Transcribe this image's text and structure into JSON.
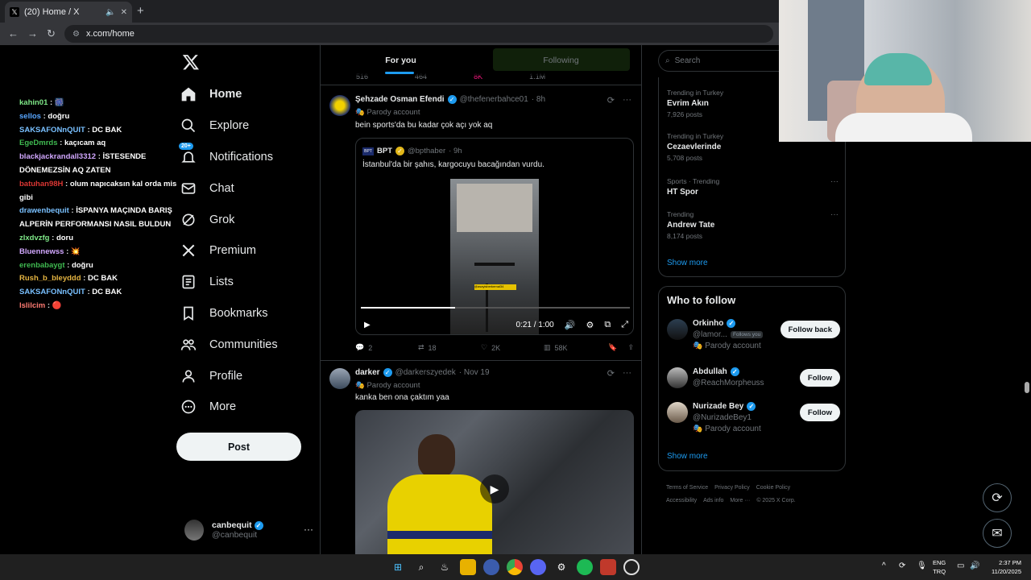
{
  "browser": {
    "tab_title": "(20) Home / X",
    "url": "x.com/home"
  },
  "chat": [
    {
      "user": "kahin01",
      "color": "#7ee787",
      "msg": "🎆"
    },
    {
      "user": "sellos",
      "color": "#58a6ff",
      "msg": "doğru"
    },
    {
      "user": "SAKSAFONnQUIT",
      "color": "#79c0ff",
      "msg": "DC BAK"
    },
    {
      "user": "EgeDmrds",
      "color": "#3fb950",
      "msg": "kaçıcam aq"
    },
    {
      "user": "blackjackrandall3312",
      "color": "#d2a8ff",
      "msg": "İSTESENDE DÖNEMEZSİN AQ ZATEN"
    },
    {
      "user": "batuhan98H",
      "color": "#da3633",
      "msg": "olum napıcaksın kal orda mis gibi"
    },
    {
      "user": "drawenbequit",
      "color": "#79c0ff",
      "msg": "İSPANYA MAÇINDA BARIŞ ALPERİN PERFORMANSI NASIL BULDUN"
    },
    {
      "user": "zlxdvzfg",
      "color": "#7ee787",
      "msg": "doru"
    },
    {
      "user": "Bluennewss",
      "color": "#d2a8ff",
      "msg": "💥"
    },
    {
      "user": "erenbabaygt",
      "color": "#3fb950",
      "msg": "doğru"
    },
    {
      "user": "Rush_b_bleyddd",
      "color": "#e3b341",
      "msg": "DC BAK"
    },
    {
      "user": "SAKSAFONnQUIT",
      "color": "#79c0ff",
      "msg": "DC BAK"
    },
    {
      "user": "lslilcim",
      "color": "#ff7b72",
      "msg": "🔴"
    }
  ],
  "nav": [
    {
      "label": "Home",
      "icon": "home-icon"
    },
    {
      "label": "Explore",
      "icon": "search-icon"
    },
    {
      "label": "Notifications",
      "icon": "bell-icon",
      "badge": "20+"
    },
    {
      "label": "Chat",
      "icon": "mail-icon"
    },
    {
      "label": "Grok",
      "icon": "grok-icon"
    },
    {
      "label": "Premium",
      "icon": "x-icon"
    },
    {
      "label": "Lists",
      "icon": "list-icon"
    },
    {
      "label": "Bookmarks",
      "icon": "bookmark-icon"
    },
    {
      "label": "Communities",
      "icon": "people-icon"
    },
    {
      "label": "Profile",
      "icon": "person-icon"
    },
    {
      "label": "More",
      "icon": "more-icon"
    }
  ],
  "post_label": "Post",
  "me": {
    "name": "canbequit",
    "handle": "@canbequit"
  },
  "feed_tabs": {
    "for_you": "For you",
    "following": "Following"
  },
  "prev_actions": [
    "516",
    "464",
    "8K",
    "1.1M"
  ],
  "tweet1": {
    "name": "Şehzade Osman Efendi",
    "handle": "@thefenerbahce01",
    "time": "· 8h",
    "parody": "Parody account",
    "text": "bein sports'da bu kadar çok açı yok aq",
    "quote": {
      "name": "BPT",
      "handle": "@bpthaber",
      "time": "· 9h",
      "logo": "BPT",
      "text": "İstanbul'da bir şahıs, kargocuyu bacağından vurdu.",
      "video_time": "0:21 / 1:00",
      "progress": 0.35,
      "caption": "@asayisberkemal34"
    },
    "actions": {
      "replies": "2",
      "reposts": "18",
      "likes": "2K",
      "views": "58K"
    }
  },
  "tweet2": {
    "name": "darker",
    "handle": "@darkerszyedek",
    "time": "· Nov 19",
    "parody": "Parody account",
    "text": "kanka ben ona çaktım yaa"
  },
  "search_placeholder": "Search",
  "trends": [
    {
      "context": "Trending in Turkey",
      "title": "Evrim Akın",
      "count": "7,926 posts"
    },
    {
      "context": "Trending in Turkey",
      "title": "Cezaevlerinde",
      "count": "5,708 posts"
    },
    {
      "context": "Sports · Trending",
      "title": "HT Spor",
      "count": ""
    },
    {
      "context": "Trending",
      "title": "Andrew Tate",
      "count": "8,174 posts"
    }
  ],
  "show_more": "Show more",
  "who_to_follow": {
    "title": "Who to follow",
    "users": [
      {
        "name": "Orkinho",
        "handle": "@lamor...",
        "follows_you": "Follows you",
        "parody": "Parody account",
        "button": "Follow back"
      },
      {
        "name": "Abdullah",
        "handle": "@ReachMorpheuss",
        "follows_you": "",
        "parody": "",
        "button": "Follow"
      },
      {
        "name": "Nurizade Bey",
        "handle": "@NurizadeBey1",
        "follows_you": "",
        "parody": "Parody account",
        "button": "Follow"
      }
    ],
    "show_more": "Show more"
  },
  "footer": {
    "links": [
      "Terms of Service",
      "Privacy Policy",
      "Cookie Policy",
      "Accessibility",
      "Ads info",
      "More ···"
    ],
    "copyright": "© 2025 X Corp."
  },
  "taskbar": {
    "lang1": "ENG",
    "lang2": "TRQ",
    "time": "2:37 PM",
    "date": "11/20/2025"
  },
  "colors": {
    "accent": "#1d9bf0",
    "bg": "#000000",
    "border": "#2f3336",
    "muted": "#71767b"
  }
}
